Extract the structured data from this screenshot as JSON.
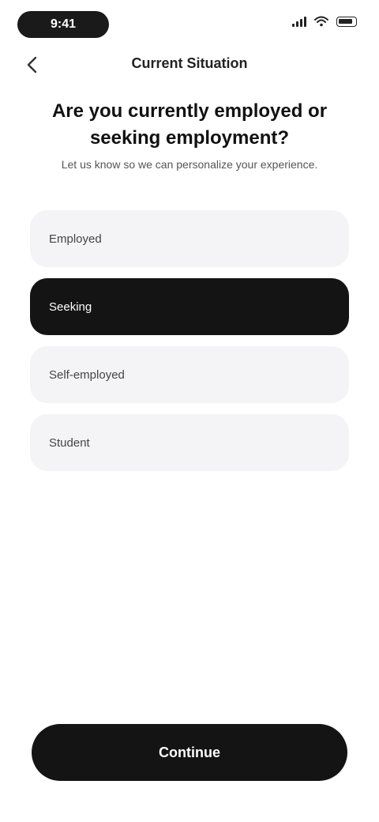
{
  "status_bar": {
    "time": "9:41"
  },
  "nav": {
    "title": "Current Situation"
  },
  "heading": "Are you currently employed or seeking employment?",
  "subheading": "Let us know so we can personalize your experience.",
  "options": [
    {
      "label": "Employed",
      "selected": false
    },
    {
      "label": "Seeking",
      "selected": true
    },
    {
      "label": "Self-employed",
      "selected": false
    },
    {
      "label": "Student",
      "selected": false
    }
  ],
  "cta_label": "Continue",
  "icons": {
    "back": "chevron-left-icon",
    "signal": "signal-icon",
    "wifi": "wifi-icon",
    "battery": "battery-icon"
  },
  "colors": {
    "selected_bg": "#141414",
    "option_bg": "#f4f4f6",
    "cta_bg": "#141414"
  }
}
